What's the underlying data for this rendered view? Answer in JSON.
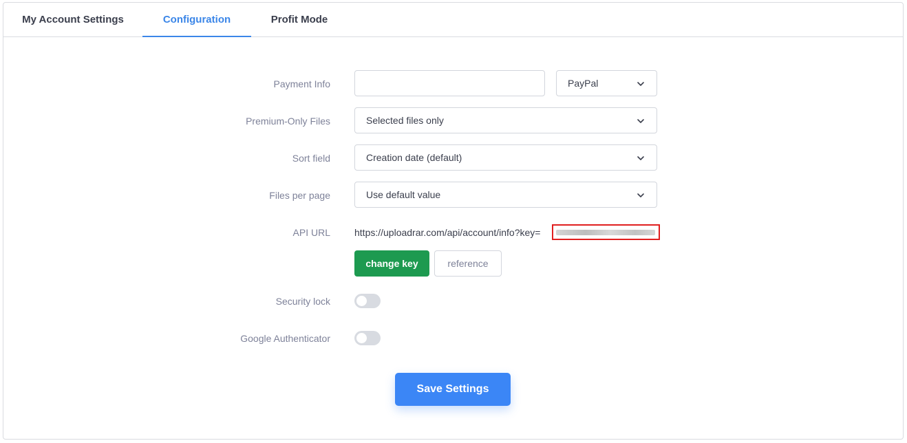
{
  "tabs": [
    {
      "label": "My Account Settings",
      "active": false
    },
    {
      "label": "Configuration",
      "active": true
    },
    {
      "label": "Profit Mode",
      "active": false
    }
  ],
  "form": {
    "payment_info": {
      "label": "Payment Info",
      "value": "",
      "method": "PayPal"
    },
    "premium_only_files": {
      "label": "Premium-Only Files",
      "value": "Selected files only"
    },
    "sort_field": {
      "label": "Sort field",
      "value": "Creation date (default)"
    },
    "files_per_page": {
      "label": "Files per page",
      "value": "Use default value"
    },
    "api_url": {
      "label": "API URL",
      "value": "https://uploadrar.com/api/account/info?key="
    },
    "change_key_label": "change key",
    "reference_label": "reference",
    "security_lock": {
      "label": "Security lock",
      "enabled": false
    },
    "google_authenticator": {
      "label": "Google Authenticator",
      "enabled": false
    }
  },
  "save_label": "Save Settings",
  "colors": {
    "accent": "#3b86e8",
    "success": "#1d9a50",
    "primary_button": "#3b86f6",
    "redaction_box": "#e01e1e"
  },
  "icons": {
    "dropdown": "chevron-down-icon"
  }
}
